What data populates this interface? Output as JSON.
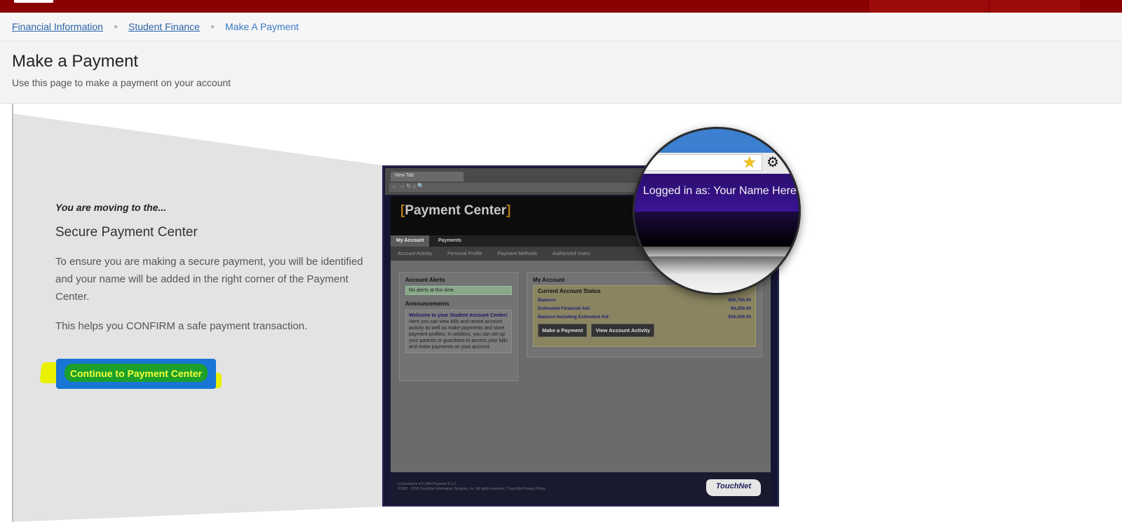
{
  "breadcrumb": {
    "items": [
      "Financial Information",
      "Student Finance"
    ],
    "current": "Make A Payment"
  },
  "page": {
    "title": "Make a Payment",
    "subtitle": "Use this page to make a payment on your account"
  },
  "intro": {
    "kicker": "You are moving to the...",
    "heading": "Secure Payment Center",
    "paragraph1": "To ensure you are making a secure payment, you will be identified and your name will be added in the right corner of the Payment Center.",
    "paragraph2": "This helps you CONFIRM a safe payment transaction.",
    "button_label": "Continue to Payment Center"
  },
  "illustration": {
    "browser_tab": "New Tab",
    "payment_center_title": "Payment Center",
    "tabs": [
      "My Account",
      "Payments"
    ],
    "subnav": [
      "Account Activity",
      "Personal Profile",
      "Payment Methods",
      "Authorized Users"
    ],
    "alerts_title": "Account Alerts",
    "alerts_text": "No alerts at this time.",
    "announcements_title": "Announcements",
    "announcement_head": "Welcome to your Student Account Center!",
    "announcement_body": "Here you can view bills and recent account activity as well as make payments and store payment profiles. In addition, you can set up your parents or guardians to access your bills and make payments on your account.",
    "my_account_title": "My Account",
    "status_title": "Current Account Status",
    "rows": [
      {
        "label": "Balance:",
        "value": "$20,750.00"
      },
      {
        "label": "Estimated Financial Aid:",
        "value": "$4,250.00"
      },
      {
        "label": "Balance Including Estimated Aid:",
        "value": "$16,500.00"
      }
    ],
    "btn_make_payment": "Make a Payment",
    "btn_view_activity": "View Account Activity",
    "footer_line1": "u.Commerce 4.5 | Bill+Payment 5.1.2",
    "footer_line2": "©1997 - 2015 TouchNet Information Systems, Inc. All rights reserved. | TouchNet Privacy Policy",
    "brand": "TouchNet",
    "logged_in": "Logged in as: Your Name Here"
  },
  "colors": {
    "topbar": "#8b0000",
    "link": "#2a62a8",
    "button": "#1876d6",
    "highlight": "#e9f000"
  }
}
